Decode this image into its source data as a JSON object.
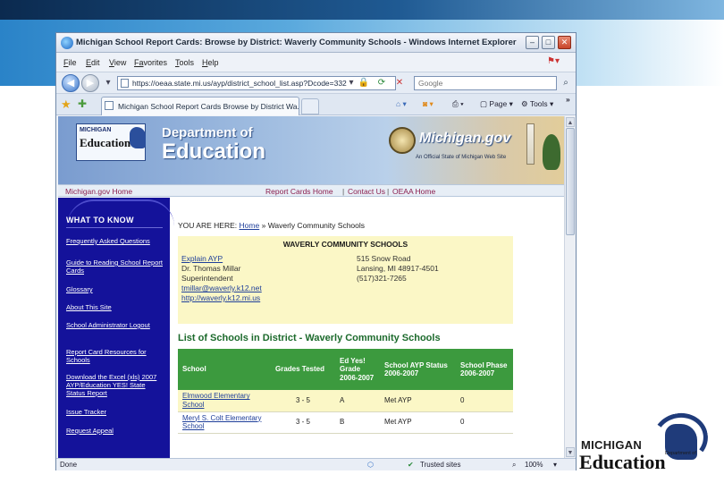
{
  "window": {
    "title": "Michigan School Report Cards: Browse by District: Waverly Community Schools - Windows Internet Explorer",
    "minimize": "–",
    "maximize": "□",
    "close": "✕"
  },
  "menu": {
    "items": [
      {
        "key": "F",
        "rest": "ile"
      },
      {
        "key": "E",
        "rest": "dit"
      },
      {
        "key": "V",
        "rest": "iew"
      },
      {
        "key": "Fa",
        "rest": "vorites"
      },
      {
        "key": "T",
        "rest": "ools"
      },
      {
        "key": "H",
        "rest": "elp"
      }
    ]
  },
  "address": {
    "url": "https://oeaa.state.mi.us/ayp/district_school_list.asp?Dcode=332",
    "search_placeholder": "Google"
  },
  "tab": {
    "label": "Michigan School Report Cards Browse by District Wa..."
  },
  "commands": {
    "page": "Page",
    "tools": "Tools",
    "more": "»"
  },
  "status": {
    "left": "Done",
    "zone": "Trusted sites",
    "zoom": "100%"
  },
  "site": {
    "banner_dept": "Department of",
    "banner_edu": "Education",
    "logo_michigan": "MICHIGAN",
    "logo_education": "Education",
    "mi_gov": "Michigan.gov",
    "mi_gov_tag": "An Official State of Michigan Web Site",
    "nav_home": "Michigan.gov Home",
    "nav_report": "Report Cards Home",
    "nav_contact": "Contact Us",
    "nav_oeaa": "OEAA Home",
    "nav_sep": "|"
  },
  "sidebar": {
    "heading": "WHAT TO KNOW",
    "links": [
      "Frequently Asked Questions",
      "Guide to Reading School Report Cards",
      "Glossary",
      "About This Site",
      "School Administrator Logout",
      "Report Card Resources for Schools",
      "Download the Excel (xls) 2007 AYP/Education YES! State Status Report",
      "Issue Tracker",
      "Request Appeal"
    ]
  },
  "main": {
    "you_are_here": "YOU ARE HERE:",
    "crumb_home": "Home",
    "crumb_sep": "»",
    "crumb_current": "Waverly Community Schools",
    "district_title": "WAVERLY COMMUNITY SCHOOLS",
    "explain_link": "Explain AYP",
    "contact_name": "Dr. Thomas Millar",
    "contact_role": "Superintendent",
    "contact_email": "tmillar@waverly.k12.net",
    "contact_web": "http://waverly.k12.mi.us",
    "address_line1": "515 Snow Road",
    "address_line2": "Lansing, MI 48917-4501",
    "phone": "(517)321-7265",
    "list_heading": "List of Schools in District - Waverly Community Schools"
  },
  "table": {
    "headers": [
      "School",
      "Grades Tested",
      "Ed Yes! Grade 2006-2007",
      "School AYP Status 2006-2007",
      "School Phase 2006-2007"
    ],
    "rows": [
      {
        "school": "Elmwood Elementary School",
        "grades": "3 - 5",
        "edyes": "A",
        "ayp": "Met AYP",
        "phase": "0"
      },
      {
        "school": "Meryl S. Colt Elementary School",
        "grades": "3 - 5",
        "edyes": "B",
        "ayp": "Met AYP",
        "phase": "0"
      }
    ]
  },
  "slide_logo": {
    "michigan": "MICHIGAN",
    "dept": "Department of",
    "education": "Education"
  },
  "colors": {
    "sidebar": "#14129a",
    "table_header": "#3c9a3e",
    "info_box": "#fbf7c6",
    "heading_green": "#1c6a2c",
    "nav_link": "#8b1f4f"
  }
}
